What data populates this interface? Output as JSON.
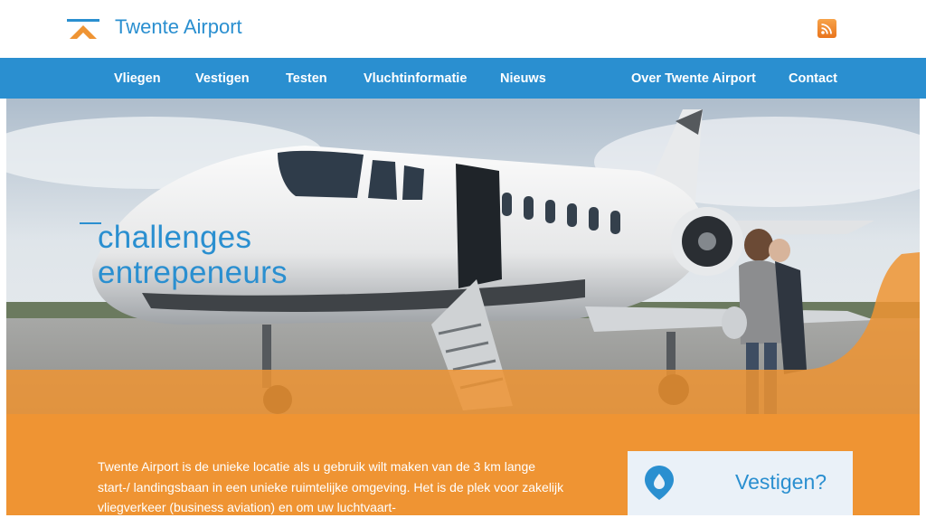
{
  "header": {
    "brand_name": "Twente Airport",
    "logo_icon": "airport-logo-icon",
    "rss_icon": "rss-icon",
    "colors": {
      "brand_blue": "#2a8fd0",
      "accent_orange": "#ef9433"
    }
  },
  "nav": {
    "items": [
      {
        "label": "Vliegen"
      },
      {
        "label": "Vestigen"
      },
      {
        "label": "Testen"
      },
      {
        "label": "Vluchtinformatie"
      },
      {
        "label": "Nieuws"
      },
      {
        "label": "Over Twente Airport"
      },
      {
        "label": "Contact"
      }
    ]
  },
  "hero": {
    "tagline_line1": "challenges",
    "tagline_line2": "entrepeneurs",
    "image": "business-jet-photo"
  },
  "content": {
    "intro_text": "Twente Airport is de unieke locatie als u gebruik wilt maken van de 3 km lange start-/ landingsbaan in een unieke ruimtelijke omgeving. Het is de plek voor zakelijk vliegverkeer (business aviation) en om uw luchtvaart-",
    "card": {
      "title": "Vestigen?",
      "icon": "location-pin-icon"
    }
  }
}
